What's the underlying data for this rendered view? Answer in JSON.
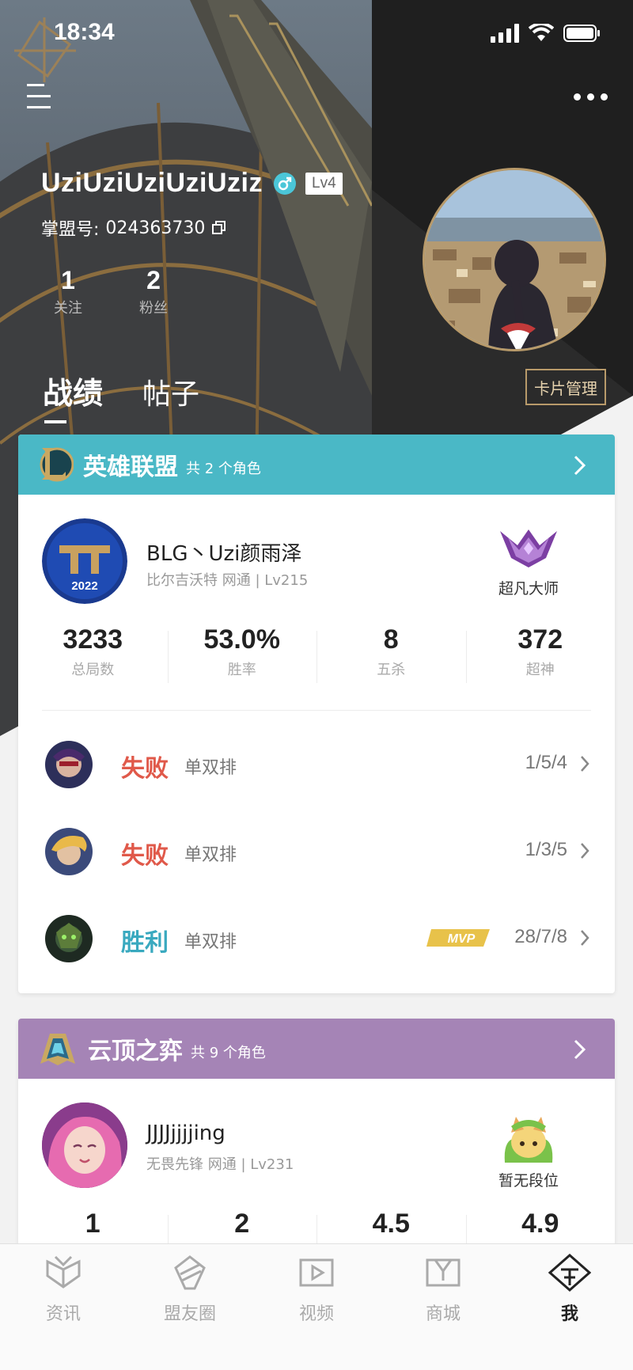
{
  "status_bar": {
    "time": "18:34"
  },
  "profile": {
    "username": "UziUziUziUziUziz",
    "level": "Lv4",
    "id_label": "掌盟号:",
    "id_value": "024363730",
    "following_count": "1",
    "following_label": "关注",
    "fans_count": "2",
    "fans_label": "粉丝"
  },
  "tabs": [
    {
      "label": "战绩",
      "active": true
    },
    {
      "label": "帖子",
      "active": false
    }
  ],
  "card_manage_label": "卡片管理",
  "lol": {
    "title": "英雄联盟",
    "subtitle": "共 2 个角色",
    "header_color": "#4ab8c6",
    "player_name": "BLG丶Uzi颜雨泽",
    "player_sub": "比尔吉沃特 网通 | Lv215",
    "avatar_year": "2022",
    "rank": "超凡大师",
    "stats": [
      {
        "value": "3233",
        "label": "总局数"
      },
      {
        "value": "53.0%",
        "label": "胜率"
      },
      {
        "value": "8",
        "label": "五杀"
      },
      {
        "value": "372",
        "label": "超神"
      }
    ],
    "matches": [
      {
        "result": "失败",
        "outcome": "lose",
        "mode": "单双排",
        "kda": "1/5/4",
        "mvp": false
      },
      {
        "result": "失败",
        "outcome": "lose",
        "mode": "单双排",
        "kda": "1/3/5",
        "mvp": false
      },
      {
        "result": "胜利",
        "outcome": "win",
        "mode": "单双排",
        "kda": "28/7/8",
        "mvp": true,
        "mvp_label": "MVP"
      }
    ]
  },
  "tft": {
    "title": "云顶之弈",
    "subtitle": "共 9 个角色",
    "header_color": "#a584b6",
    "player_name": "JJJJjjjjing",
    "player_sub": "无畏先锋 网通 | Lv231",
    "rank": "暂无段位",
    "stats": [
      {
        "value": "1"
      },
      {
        "value": "2"
      },
      {
        "value": "4.5"
      },
      {
        "value": "4.9"
      }
    ]
  },
  "bottom_nav": [
    {
      "label": "资讯",
      "icon": "news-icon",
      "active": false
    },
    {
      "label": "盟友圈",
      "icon": "friends-circle-icon",
      "active": false
    },
    {
      "label": "视频",
      "icon": "video-icon",
      "active": false
    },
    {
      "label": "商城",
      "icon": "shop-icon",
      "active": false
    },
    {
      "label": "我",
      "icon": "me-icon",
      "active": true
    }
  ]
}
